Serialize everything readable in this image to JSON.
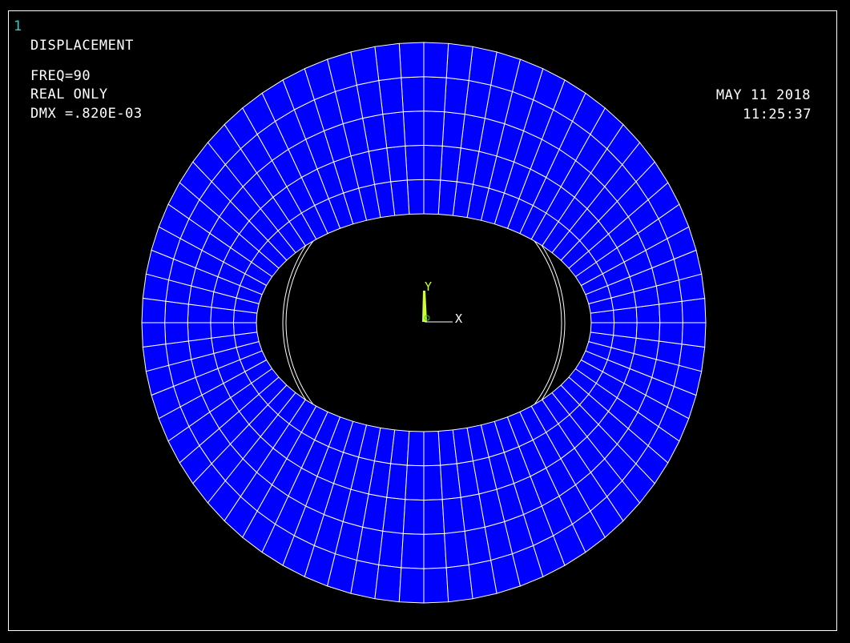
{
  "window": {
    "number": "1"
  },
  "plot": {
    "title": "DISPLACEMENT",
    "lines": [
      "FREQ=90",
      "REAL ONLY",
      "DMX =.820E-03"
    ],
    "date": "MAY 11 2018",
    "time": "11:25:37"
  },
  "triad": {
    "y_label": "Y",
    "x_label": "X",
    "z_label": "Z"
  },
  "colors": {
    "background": "#000000",
    "mesh_fill": "#0000ff",
    "mesh_edges": "#ffffff",
    "window_number": "#33cccc",
    "triad_y": "#ccff33",
    "triad_x": "#ffffff",
    "triad_z": "#33cc33"
  },
  "mesh": {
    "radial_divisions": 5,
    "circumferential_divisions": 72
  }
}
